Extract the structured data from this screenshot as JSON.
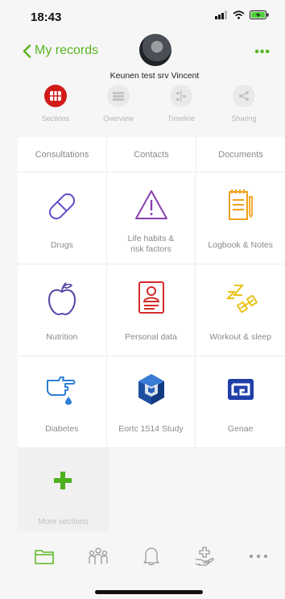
{
  "status_bar": {
    "time": "18:43"
  },
  "nav": {
    "back_label": "My records",
    "patient_name": "Keunen test srv Vincent"
  },
  "tabs": [
    {
      "label": "Sections",
      "icon": "grid-icon",
      "active": true
    },
    {
      "label": "Overview",
      "icon": "list-icon",
      "active": false
    },
    {
      "label": "Timeline",
      "icon": "timeline-icon",
      "active": false
    },
    {
      "label": "Sharing",
      "icon": "share-icon",
      "active": false
    }
  ],
  "top_links": [
    "Consultations",
    "Contacts",
    "Documents"
  ],
  "tiles": [
    {
      "label": "Drugs",
      "icon": "pill-icon"
    },
    {
      "label": "Life habits &\nrisk factors",
      "icon": "warning-icon"
    },
    {
      "label": "Logbook & Notes",
      "icon": "notebook-icon"
    },
    {
      "label": "Nutrition",
      "icon": "apple-icon"
    },
    {
      "label": "Personal data",
      "icon": "id-card-icon"
    },
    {
      "label": "Workout & sleep",
      "icon": "dumbbell-sleep-icon"
    },
    {
      "label": "Diabetes",
      "icon": "finger-drop-icon"
    },
    {
      "label": "Eortc 1514 Study",
      "icon": "eortc-logo-icon"
    },
    {
      "label": "Genae",
      "icon": "genae-logo-icon"
    }
  ],
  "more_sections": {
    "label": "More sections",
    "icon": "plus-icon"
  },
  "bottom_tabs": [
    "folder-icon",
    "people-icon",
    "bell-icon",
    "hand-cross-icon",
    "more-icon"
  ],
  "colors": {
    "accent_green": "#5bb522",
    "active_red": "#d11a1a",
    "drugs_purple": "#5d4fc9",
    "warning_purple": "#8a3fb0",
    "logbook_orange": "#f0a21a",
    "nutrition_purple": "#5348a8",
    "personal_red": "#d42a2a",
    "workout_yellow": "#e9c21a",
    "diabetes_blue": "#2f7fd6",
    "genae_blue": "#1f3fa8"
  }
}
